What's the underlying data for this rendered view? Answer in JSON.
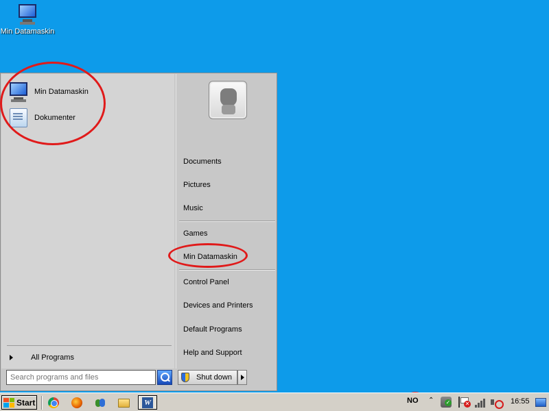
{
  "desktop": {
    "icons": [
      {
        "label": "Min Datamaskin",
        "icon": "computer-icon"
      }
    ]
  },
  "start_menu": {
    "pinned": [
      {
        "label": "Min Datamaskin",
        "icon": "computer-icon"
      },
      {
        "label": "Dokumenter",
        "icon": "documents-icon"
      }
    ],
    "all_programs_label": "All Programs",
    "search_placeholder": "Search programs and files",
    "shutdown_label": "Shut down",
    "right_items": {
      "documents": "Documents",
      "pictures": "Pictures",
      "music": "Music",
      "games": "Games",
      "min_datamaskin": "Min Datamaskin",
      "control_panel": "Control Panel",
      "devices_printers": "Devices and Printers",
      "default_programs": "Default Programs",
      "help_support": "Help and Support"
    }
  },
  "taskbar": {
    "start_label": "Start",
    "quick_launch": [
      "chrome-icon",
      "firefox-icon",
      "people-icon",
      "folder-icon"
    ],
    "active_app_icon": "word-icon",
    "active_app_glyph": "W",
    "tray": {
      "language": "NO",
      "clock": "16:55"
    }
  },
  "colors": {
    "desktop_bg": "#0d9bea",
    "annotation": "#e01a1a"
  }
}
